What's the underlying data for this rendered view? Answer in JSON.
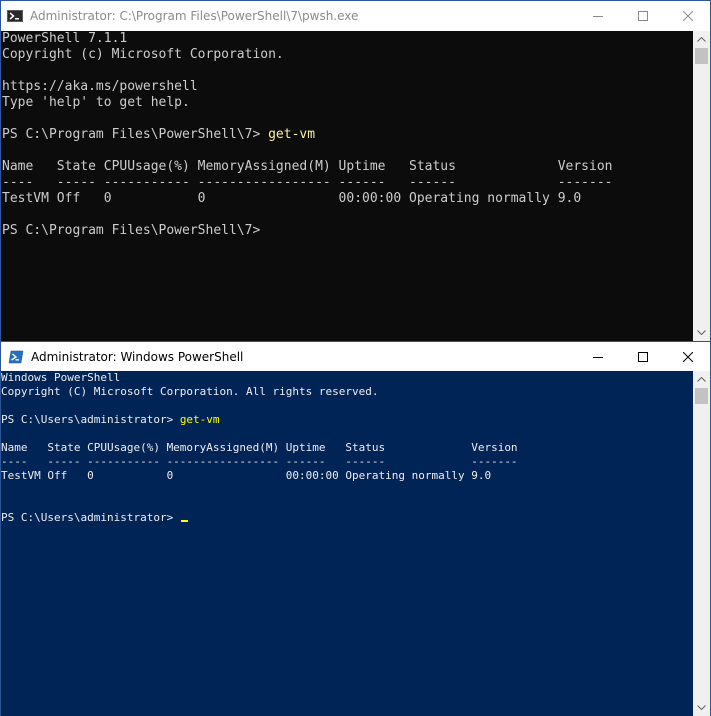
{
  "window1": {
    "title": "Administrator: C:\\Program Files\\PowerShell\\7\\pwsh.exe",
    "lines": [
      {
        "text": "PowerShell 7.1.1",
        "cmd": ""
      },
      {
        "text": "Copyright (c) Microsoft Corporation.",
        "cmd": ""
      },
      {
        "text": "",
        "cmd": ""
      },
      {
        "text": "https://aka.ms/powershell",
        "cmd": ""
      },
      {
        "text": "Type 'help' to get help.",
        "cmd": ""
      },
      {
        "text": "",
        "cmd": ""
      },
      {
        "text": "PS C:\\Program Files\\PowerShell\\7> ",
        "cmd": "get-vm"
      },
      {
        "text": "",
        "cmd": ""
      },
      {
        "text": "Name   State CPUUsage(%) MemoryAssigned(M) Uptime   Status             Version",
        "cmd": ""
      },
      {
        "text": "----   ----- ----------- ----------------- ------   ------             -------",
        "cmd": ""
      },
      {
        "text": "TestVM Off   0           0                 00:00:00 Operating normally 9.0",
        "cmd": ""
      },
      {
        "text": "",
        "cmd": ""
      },
      {
        "text": "PS C:\\Program Files\\PowerShell\\7>",
        "cmd": ""
      }
    ]
  },
  "window2": {
    "title": "Administrator: Windows PowerShell",
    "lines": [
      {
        "text": "Windows PowerShell",
        "cmd": ""
      },
      {
        "text": "Copyright (C) Microsoft Corporation. All rights reserved.",
        "cmd": ""
      },
      {
        "text": "",
        "cmd": ""
      },
      {
        "text": "PS C:\\Users\\administrator> ",
        "cmd": "get-vm"
      },
      {
        "text": "",
        "cmd": ""
      },
      {
        "text": "Name   State CPUUsage(%) MemoryAssigned(M) Uptime   Status             Version",
        "cmd": ""
      },
      {
        "text": "----   ----- ----------- ----------------- ------   ------             -------",
        "cmd": ""
      },
      {
        "text": "TestVM Off   0           0                 00:00:00 Operating normally 9.0",
        "cmd": ""
      },
      {
        "text": "",
        "cmd": ""
      },
      {
        "text": "",
        "cmd": ""
      },
      {
        "text": "PS C:\\Users\\administrator> ",
        "cmd": ""
      }
    ],
    "cursor_line": 10
  },
  "colors": {
    "pwsh_bg": "#0c0c0c",
    "winps_bg": "#012456",
    "pwsh_command": "#f9f1a5",
    "winps_command": "#ffff00"
  },
  "icons": [
    "powershell-icon",
    "minimize-icon",
    "maximize-icon",
    "close-icon",
    "scroll-up-arrow-icon",
    "scroll-down-arrow-icon"
  ]
}
